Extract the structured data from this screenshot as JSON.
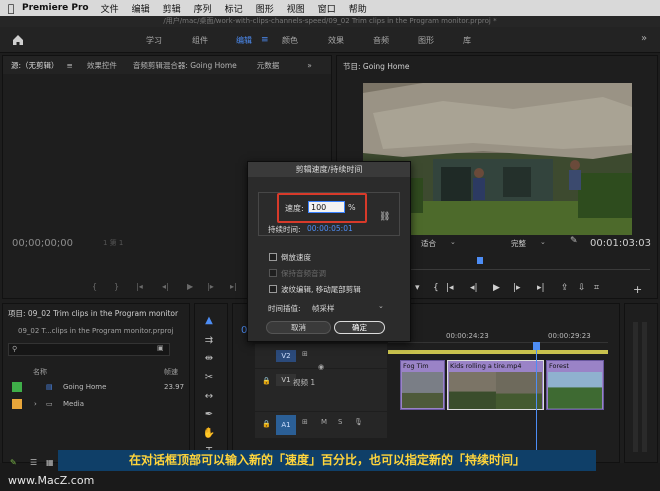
{
  "menubar": {
    "app": "Premiere Pro",
    "items": [
      "文件",
      "编辑",
      "剪辑",
      "序列",
      "标记",
      "图形",
      "视图",
      "窗口",
      "帮助"
    ]
  },
  "titlebar": {
    "path": "/用户/mac/桌面/work-with-clips-channels-speed/09_02 Trim clips in the Program monitor.prproj *"
  },
  "workspaces": {
    "tabs": [
      "学习",
      "组件",
      "编辑",
      "颜色",
      "效果",
      "音频",
      "图形",
      "库"
    ],
    "active": "编辑",
    "more": "»"
  },
  "source_panel": {
    "tabs": [
      "源:（无剪辑）",
      "效果控件",
      "音频剪辑混合器: Going Home",
      "元数据"
    ],
    "timecode": "00;00;00;00",
    "fit": "1 第 1"
  },
  "program_panel": {
    "title": "节目: Going Home",
    "fit": "适合",
    "quality": "完整",
    "timecode": "00:01:03:03"
  },
  "project_panel": {
    "title": "项目: 09_02 Trim clips in the Program monitor",
    "file": "09_02 T...clips in the Program monitor.prproj",
    "col_name": "名称",
    "col_framerate": "帧速",
    "items": [
      {
        "name": "Going Home",
        "framerate": "23.97",
        "color": "#3fae49"
      },
      {
        "name": "Media",
        "framerate": "",
        "color": "#e8a63a"
      }
    ]
  },
  "timeline": {
    "timecode": "00",
    "ruler_1": "00:00:24:23",
    "ruler_2": "00:00:29:23",
    "tracks": {
      "v2": "V2",
      "v1": "V1",
      "v1_label": "视频 1",
      "a1": "A1"
    },
    "clips": [
      "Fog Tim",
      "Kids rolling a tire.mp4",
      "Forest"
    ]
  },
  "dialog": {
    "title": "剪辑速度/持续时间",
    "speed_label": "速度:",
    "speed_value": "100",
    "speed_unit": "%",
    "duration_label": "持续时间:",
    "duration_value": "00:00:05:01",
    "checkboxes": [
      {
        "label": "倒放速度",
        "enabled": true
      },
      {
        "label": "保持音频音调",
        "enabled": false
      },
      {
        "label": "波纹编辑, 移动尾部剪辑",
        "enabled": true
      }
    ],
    "interp_label": "时间插值:",
    "interp_value": "帧采样",
    "cancel": "取消",
    "ok": "确定"
  },
  "caption": "在对话框顶部可以输入新的「速度」百分比，也可以指定新的「持续时间」",
  "watermark": "www.MacZ.com"
}
